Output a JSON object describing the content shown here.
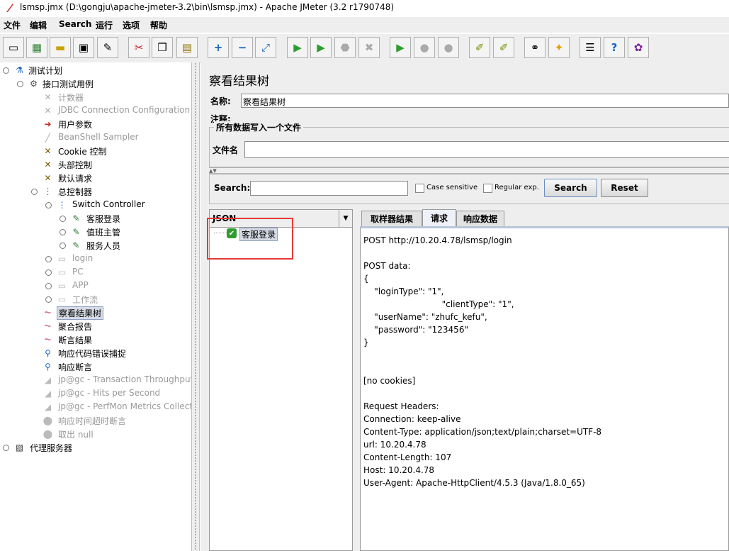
{
  "window": {
    "title": "lsmsp.jmx (D:\\gongju\\apache-jmeter-3.2\\bin\\lsmsp.jmx) - Apache JMeter (3.2 r1790748)"
  },
  "menu": [
    "文件",
    "编辑",
    "Search",
    "运行",
    "选项",
    "帮助"
  ],
  "toolbar": {
    "icons": [
      "new-icon",
      "templates-icon",
      "open-icon",
      "save-icon",
      "save-as-icon",
      "cut-icon",
      "copy-icon",
      "paste-icon",
      "expand-icon",
      "collapse-icon",
      "toggle-icon",
      "start-icon",
      "start-no-pause-icon",
      "stop-icon",
      "shutdown-icon",
      "remote-start-icon",
      "remote-stop-icon",
      "remote-shutdown-icon",
      "clear-icon",
      "clear-all-icon",
      "search-icon",
      "reset-search-icon",
      "function-helper-icon",
      "help-icon",
      "logger-icon"
    ]
  },
  "tree": {
    "root": "测试计划",
    "thread_group": "接口测试用例",
    "items": [
      {
        "label": "计数器",
        "disabled": true
      },
      {
        "label": "JDBC Connection Configuration",
        "disabled": true
      },
      {
        "label": "用户参数",
        "disabled": false
      },
      {
        "label": "BeanShell Sampler",
        "disabled": true
      },
      {
        "label": "Cookie 控制",
        "disabled": false
      },
      {
        "label": "头部控制",
        "disabled": false
      },
      {
        "label": "默认请求",
        "disabled": false
      },
      {
        "label": "总控制器",
        "disabled": false
      },
      {
        "label": "Switch Controller",
        "disabled": false
      },
      {
        "label": "客服登录",
        "disabled": false
      },
      {
        "label": "值班主管",
        "disabled": false
      },
      {
        "label": "服务人员",
        "disabled": false
      },
      {
        "label": "login",
        "disabled": true
      },
      {
        "label": "PC",
        "disabled": true
      },
      {
        "label": "APP",
        "disabled": true
      },
      {
        "label": "工作流",
        "disabled": true
      },
      {
        "label": "察看结果树",
        "disabled": false,
        "selected": true
      },
      {
        "label": "聚合报告",
        "disabled": false
      },
      {
        "label": "断言结果",
        "disabled": false
      },
      {
        "label": "响应代码错误捕捉",
        "disabled": false
      },
      {
        "label": "响应断言",
        "disabled": false
      },
      {
        "label": "jp@gc - Transaction Throughput vs",
        "disabled": true
      },
      {
        "label": "jp@gc - Hits per Second",
        "disabled": true
      },
      {
        "label": "jp@gc - PerfMon Metrics Collector",
        "disabled": true
      },
      {
        "label": "响应时间超时断言",
        "disabled": true
      },
      {
        "label": "取出 null",
        "disabled": true
      }
    ],
    "proxy": "代理服务器"
  },
  "panel": {
    "title": "察看结果树",
    "name_label": "名称:",
    "name_value": "察看结果树",
    "comment_label": "注释:",
    "file_group_label": "所有数据写入一个文件",
    "filename_label": "文件名"
  },
  "search": {
    "label": "Search:",
    "value": "",
    "case_sensitive": "Case sensitive",
    "regular_exp": "Regular exp.",
    "search_button": "Search",
    "reset_button": "Reset"
  },
  "results": {
    "renderer": "JSON",
    "tree_item": "客服登录",
    "tabs": [
      "取样器结果",
      "请求",
      "响应数据"
    ],
    "active_tab": 1,
    "request_lines": [
      "POST http://10.20.4.78/lsmsp/login",
      "",
      "POST data:",
      "{",
      "    \"loginType\": \"1\",",
      "                             \"clientType\": \"1\",",
      "    \"userName\": \"zhufc_kefu\",",
      "    \"password\": \"123456\"",
      "}",
      "",
      "",
      "[no cookies]",
      "",
      "Request Headers:",
      "Connection: keep-alive",
      "Content-Type: application/json;text/plain;charset=UTF-8",
      "url: 10.20.4.78",
      "Content-Length: 107",
      "Host: 10.20.4.78",
      "User-Agent: Apache-HttpClient/4.5.3 (Java/1.8.0_65)"
    ]
  }
}
